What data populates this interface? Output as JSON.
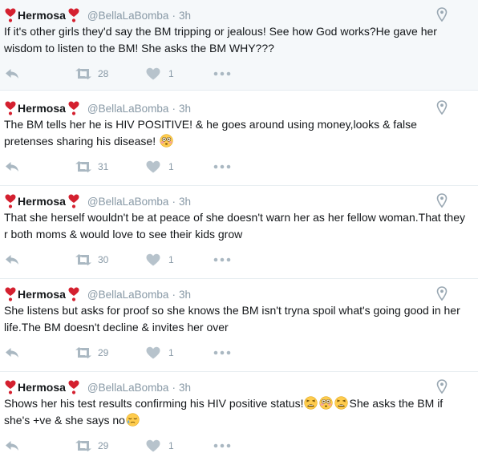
{
  "colors": {
    "muted": "#8899a6",
    "heart_emoji": "#d4202f",
    "text": "#14171a",
    "highlight_bg": "#f5f8fa"
  },
  "tweets": [
    {
      "name": "Hermosa",
      "handle": "@BellaLaBomba",
      "separator": "·",
      "time": "3h",
      "text": "If it's other girls they'd say the BM tripping or jealous! See how God works?He gave her wisdom to listen to the BM! She asks the BM WHY???",
      "retweets": "28",
      "likes": "1"
    },
    {
      "name": "Hermosa",
      "handle": "@BellaLaBomba",
      "separator": "·",
      "time": "3h",
      "text": "The BM tells her he is HIV POSITIVE! & he goes around using money,looks & false pretenses sharing his disease!",
      "retweets": "31",
      "likes": "1"
    },
    {
      "name": "Hermosa",
      "handle": "@BellaLaBomba",
      "separator": "·",
      "time": "3h",
      "text": "That she herself wouldn't be at peace of she doesn't warn her as her fellow woman.That they r both moms & would love to see their kids grow",
      "retweets": "30",
      "likes": "1"
    },
    {
      "name": "Hermosa",
      "handle": "@BellaLaBomba",
      "separator": "·",
      "time": "3h",
      "text": "She listens but asks for proof so she knows the BM isn't tryna spoil what's going good in her life.The BM doesn't decline & invites her over",
      "retweets": "29",
      "likes": "1"
    },
    {
      "name": "Hermosa",
      "handle": "@BellaLaBomba",
      "separator": "·",
      "time": "3h",
      "text_part1": "Shows her his test results confirming his HIV positive status!",
      "text_part2": "She asks the BM if she's +ve & she says no",
      "retweets": "29",
      "likes": "1"
    }
  ]
}
